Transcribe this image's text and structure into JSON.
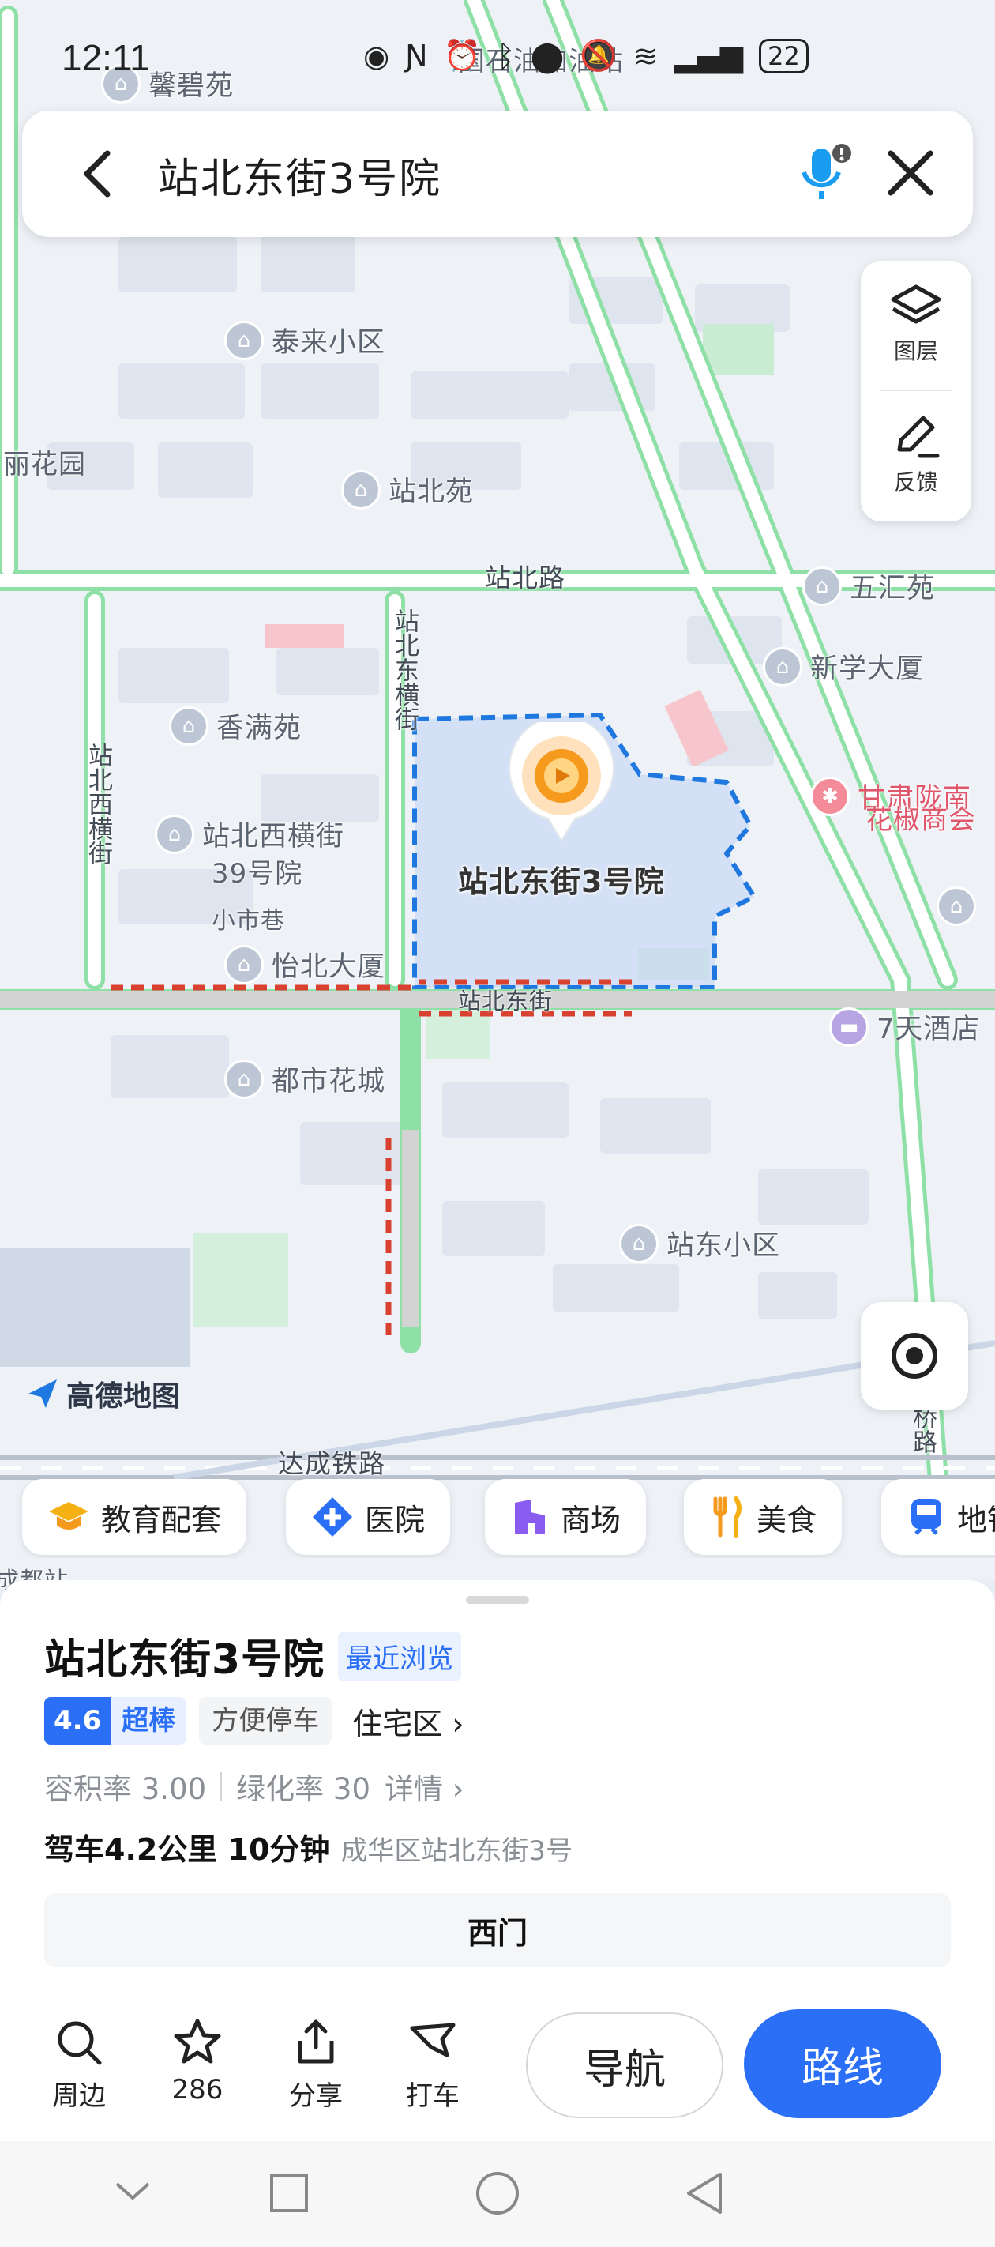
{
  "status_bar": {
    "time": "12:11",
    "battery": "22"
  },
  "search": {
    "query": "站北东街3号院"
  },
  "map_controls": {
    "layers_label": "图层",
    "feedback_label": "反馈"
  },
  "map": {
    "brand": "高德地图",
    "selected_label": "站北东街3号院",
    "places": [
      {
        "name": "馨碧苑"
      },
      {
        "name": "国石油加油站"
      },
      {
        "name": "泰来小区"
      },
      {
        "name": "丽花园"
      },
      {
        "name": "站北苑"
      },
      {
        "name": "五汇苑"
      },
      {
        "name": "新学大厦"
      },
      {
        "name": "香满苑"
      },
      {
        "name": "甘肃陇南"
      },
      {
        "name": "花椒商会"
      },
      {
        "name": "站北西横街"
      },
      {
        "name": "39号院"
      },
      {
        "name": "小市巷"
      },
      {
        "name": "怡北大厦"
      },
      {
        "name": "7天酒店"
      },
      {
        "name": "都市花城"
      },
      {
        "name": "站东小区"
      }
    ],
    "roads": [
      {
        "name": "站北路"
      },
      {
        "name": "站北东横街"
      },
      {
        "name": "站北西横街"
      },
      {
        "name": "站北东街"
      },
      {
        "name": "达成铁路"
      },
      {
        "name": "桥路"
      },
      {
        "name": "成都站"
      }
    ]
  },
  "categories": [
    {
      "label": "教育配套",
      "icon": "graduation-cap-icon"
    },
    {
      "label": "医院",
      "icon": "hospital-cross-icon"
    },
    {
      "label": "商场",
      "icon": "mall-icon"
    },
    {
      "label": "美食",
      "icon": "fork-knife-icon"
    },
    {
      "label": "地铁",
      "icon": "metro-icon"
    }
  ],
  "place": {
    "title": "站北东街3号院",
    "recent_tag": "最近浏览",
    "rating": "4.6",
    "rating_label": "超棒",
    "tag": "方便停车",
    "type": "住宅区",
    "plot_ratio": "容积率 3.00",
    "green_ratio": "绿化率 30",
    "details": "详情",
    "drive": "驾车4.2公里 10分钟",
    "address": "成华区站北东街3号",
    "gate": "西门"
  },
  "actions": {
    "nearby": "周边",
    "favorites": "286",
    "share": "分享",
    "taxi": "打车",
    "navigate": "导航",
    "route": "路线"
  },
  "colors": {
    "accent": "#2A6FF5",
    "road": "#8EE0A6",
    "boundary": "#1E78E0",
    "dash_red": "#D8412F"
  }
}
